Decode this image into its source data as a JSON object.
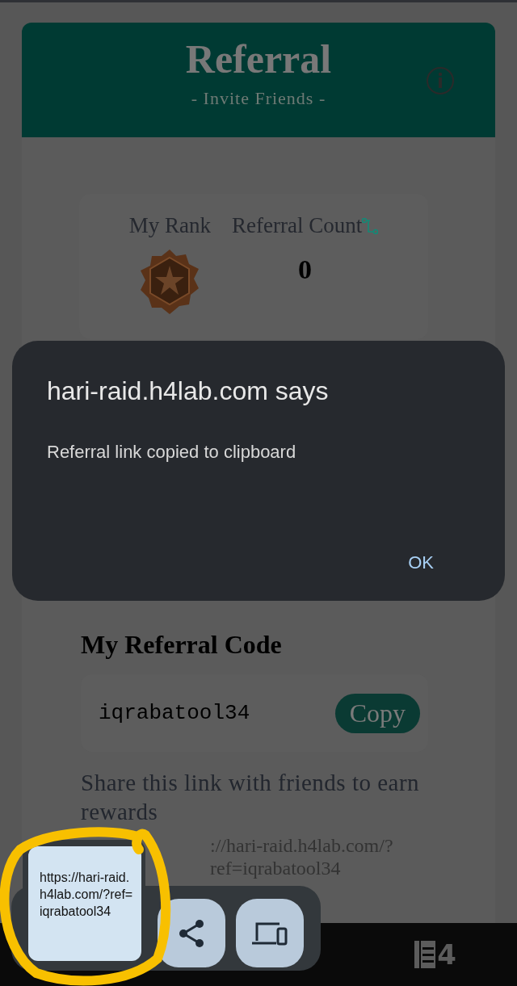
{
  "header": {
    "title": "Referral",
    "subtitle": "- Invite Friends -"
  },
  "stats": {
    "rank_label": "My Rank",
    "count_label": "Referral Count",
    "count": "0"
  },
  "referral_code": {
    "heading": "My Referral Code",
    "code": "iqrabatool34",
    "copy_button": "Copy"
  },
  "share": {
    "text": "Share this link with friends to earn rewards",
    "link": "://hari-raid.h4lab.com/?ref=iqrabatool34"
  },
  "bottom_bar": {
    "logo": "4"
  },
  "dialog": {
    "title": "hari-raid.h4lab.com says",
    "message": "Referral link copied to clipboard",
    "button": "OK"
  },
  "clipboard_preview": {
    "text": "https://hari-raid.h4lab.com/?ref=iqrabatool34"
  }
}
